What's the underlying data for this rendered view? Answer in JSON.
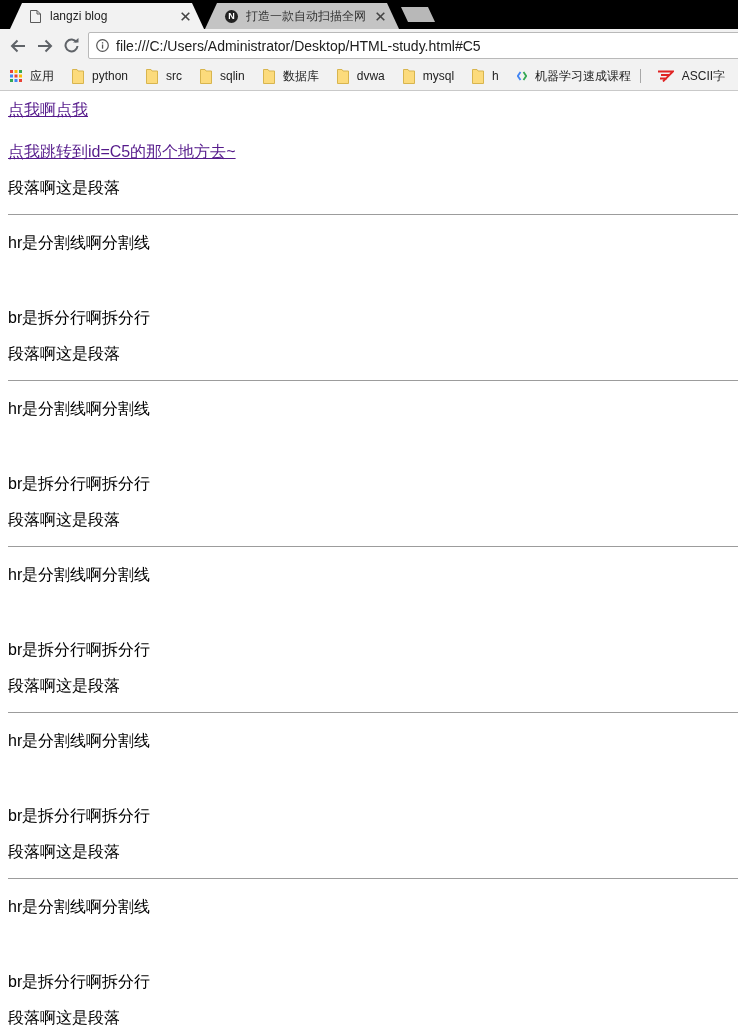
{
  "browser": {
    "tabs": [
      {
        "kind": "page",
        "title": "langzi blog",
        "selected": true
      },
      {
        "kind": "letter",
        "letter": "N",
        "title": "打造一款自动扫描全网",
        "selected": false
      }
    ],
    "address_bar": {
      "url": "file:///C:/Users/Administrator/Desktop/HTML-study.html#C5"
    },
    "bookmarks": [
      {
        "kind": "apps",
        "label": "应用"
      },
      {
        "kind": "folder",
        "label": "python"
      },
      {
        "kind": "folder",
        "label": "src"
      },
      {
        "kind": "folder",
        "label": "sqlin"
      },
      {
        "kind": "folder",
        "label": "数据库"
      },
      {
        "kind": "folder",
        "label": "dvwa"
      },
      {
        "kind": "folder",
        "label": "mysql"
      },
      {
        "kind": "folder",
        "label": "h"
      },
      {
        "kind": "code",
        "label": "机器学习速成课程"
      },
      {
        "kind": "separator"
      },
      {
        "kind": "logo",
        "label": "ASCII字"
      }
    ]
  },
  "page": {
    "blocks": [
      {
        "kind": "link",
        "text": "点我啊点我",
        "visited": true
      },
      {
        "kind": "link",
        "text": "点我跳转到id=C5的那个地方去~",
        "visited": true
      },
      {
        "kind": "paragraph",
        "text": "段落啊这是段落"
      },
      {
        "kind": "rule"
      },
      {
        "kind": "text",
        "text": "hr是分割线啊分割线"
      },
      {
        "kind": "break"
      },
      {
        "kind": "text",
        "text": "br是拆分行啊拆分行"
      },
      {
        "kind": "paragraph",
        "text": "段落啊这是段落"
      },
      {
        "kind": "rule"
      },
      {
        "kind": "text",
        "text": "hr是分割线啊分割线"
      },
      {
        "kind": "break"
      },
      {
        "kind": "text",
        "text": "br是拆分行啊拆分行"
      },
      {
        "kind": "paragraph",
        "text": "段落啊这是段落"
      },
      {
        "kind": "rule"
      },
      {
        "kind": "text",
        "text": "hr是分割线啊分割线"
      },
      {
        "kind": "break"
      },
      {
        "kind": "text",
        "text": "br是拆分行啊拆分行"
      },
      {
        "kind": "paragraph",
        "text": "段落啊这是段落"
      },
      {
        "kind": "rule"
      },
      {
        "kind": "text",
        "text": "hr是分割线啊分割线"
      },
      {
        "kind": "break"
      },
      {
        "kind": "text",
        "text": "br是拆分行啊拆分行"
      },
      {
        "kind": "paragraph",
        "text": "段落啊这是段落"
      },
      {
        "kind": "rule"
      },
      {
        "kind": "text",
        "text": "hr是分割线啊分割线"
      },
      {
        "kind": "break"
      },
      {
        "kind": "text",
        "text": "br是拆分行啊拆分行"
      },
      {
        "kind": "paragraph",
        "text": "段落啊这是段落"
      }
    ]
  }
}
